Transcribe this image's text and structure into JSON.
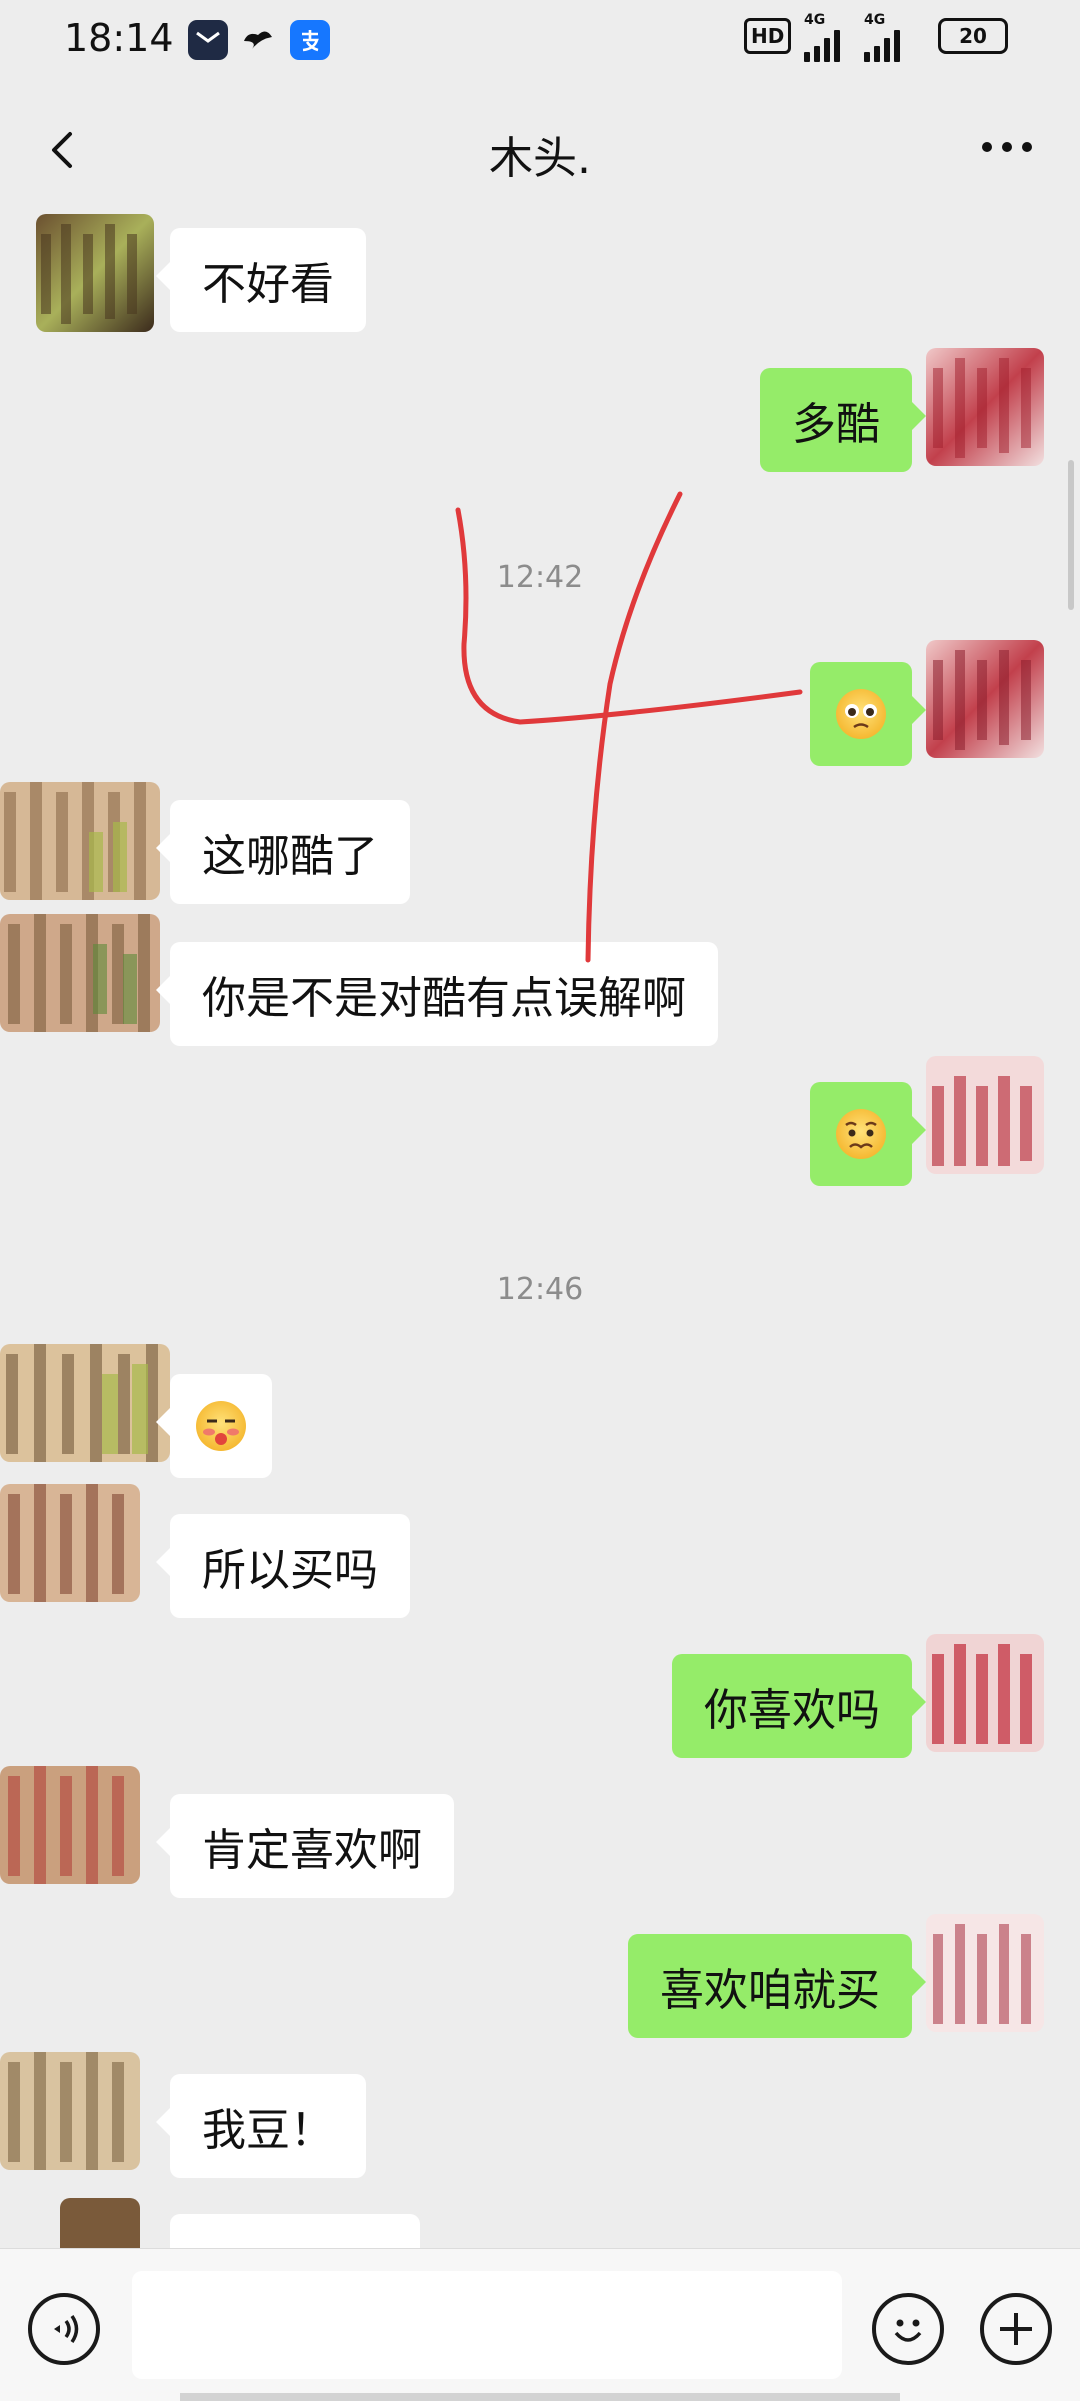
{
  "status_bar": {
    "time": "18:14",
    "net_type_1": "4G",
    "net_type_2": "4G",
    "hd_label": "HD",
    "battery": "20"
  },
  "header": {
    "title": "木头."
  },
  "messages": [
    {
      "side": "in",
      "text": "不好看"
    },
    {
      "side": "out",
      "text": "多酷"
    },
    {
      "type": "time",
      "text": "12:42"
    },
    {
      "side": "out",
      "emoji": "pleading-face-emoji"
    },
    {
      "side": "in",
      "text": "这哪酷了"
    },
    {
      "side": "in",
      "text": "你是不是对酷有点误解啊"
    },
    {
      "side": "out",
      "emoji": "worried-face-emoji"
    },
    {
      "type": "time",
      "text": "12:46"
    },
    {
      "side": "in",
      "emoji": "blushing-face-emoji"
    },
    {
      "side": "in",
      "text": "所以买吗"
    },
    {
      "side": "out",
      "text": "你喜欢吗"
    },
    {
      "side": "in",
      "text": "肯定喜欢啊"
    },
    {
      "side": "out",
      "text": "喜欢咱就买"
    },
    {
      "side": "in",
      "text": "我豆！"
    }
  ],
  "input": {
    "value": "",
    "placeholder": ""
  },
  "icons": {
    "back": "chevron-left-icon",
    "more": "more-dots-icon",
    "voice": "voice-icon",
    "emoji": "emoji-icon",
    "add": "plus-icon"
  },
  "colors": {
    "background": "#ededed",
    "incoming_bubble": "#ffffff",
    "outgoing_bubble": "#95ec69",
    "timestamp": "#8c8c8c",
    "annotation": "#e0393b"
  }
}
